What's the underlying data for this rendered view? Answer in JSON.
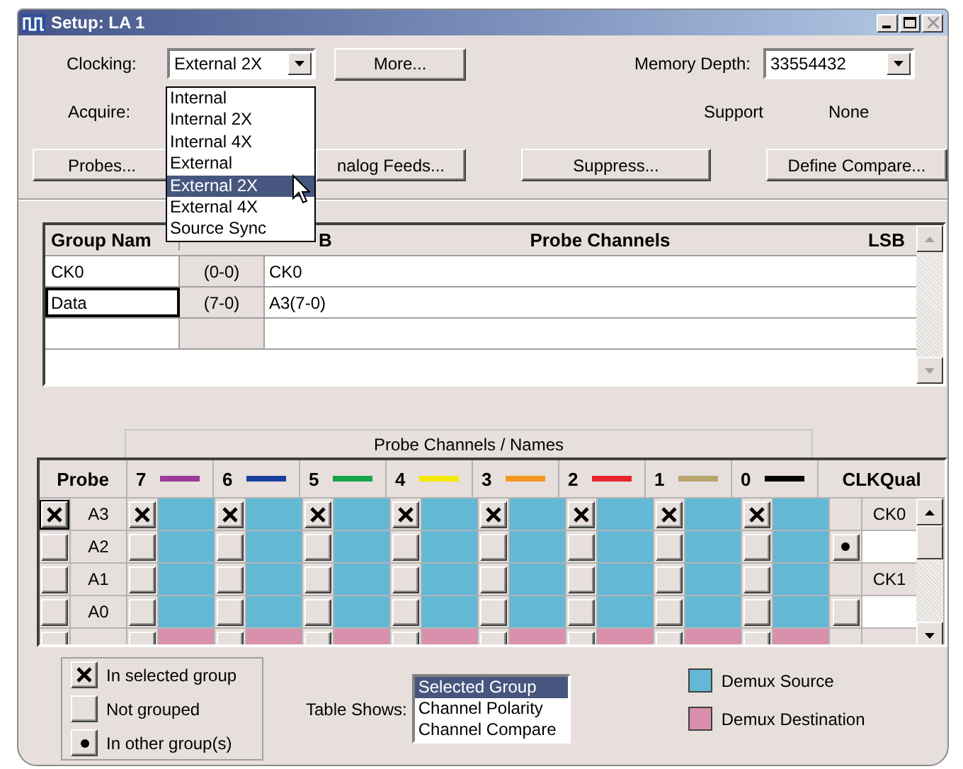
{
  "window": {
    "title": "Setup: LA 1"
  },
  "clocking": {
    "label": "Clocking:",
    "value": "External 2X",
    "options": [
      {
        "label": "Internal",
        "selected": false
      },
      {
        "label": "Internal 2X",
        "selected": false
      },
      {
        "label": "Internal 4X",
        "selected": false
      },
      {
        "label": "External",
        "selected": false
      },
      {
        "label": "External 2X",
        "selected": true
      },
      {
        "label": "External 4X",
        "selected": false
      },
      {
        "label": "Source Sync",
        "selected": false
      }
    ]
  },
  "more_button": "More...",
  "memory_depth": {
    "label": "Memory Depth:",
    "value": "33554432"
  },
  "acquire_label": "Acquire:",
  "support": {
    "label": "Support",
    "value": "None"
  },
  "buttons": [
    "Probes...",
    "nalog Feeds...",
    "Suppress...",
    "Define Compare..."
  ],
  "group_table": {
    "group_header": "Group Nam",
    "msb_header": "B",
    "channels_header": "Probe Channels",
    "lsb_header": "LSB",
    "rows": [
      {
        "name": "CK0",
        "range": "(0-0)",
        "channels": "CK0",
        "selected": false
      },
      {
        "name": "Data",
        "range": "(7-0)",
        "channels": "A3(7-0)",
        "selected": true
      }
    ]
  },
  "probe_grid": {
    "caption": "Probe Channels / Names",
    "probe_header": "Probe",
    "clk_header": "CLKQual",
    "channels": [
      {
        "label": "7",
        "color": "#9b3a9b"
      },
      {
        "label": "6",
        "color": "#1a3fa0"
      },
      {
        "label": "5",
        "color": "#17a34a"
      },
      {
        "label": "4",
        "color": "#f5e900"
      },
      {
        "label": "3",
        "color": "#f7961e"
      },
      {
        "label": "2",
        "color": "#e8242c"
      },
      {
        "label": "1",
        "color": "#b9a66e"
      },
      {
        "label": "0",
        "color": "#000000"
      }
    ],
    "rows": [
      {
        "probe": "A3",
        "kind": "source",
        "checked": true,
        "channels": [
          true,
          true,
          true,
          true,
          true,
          true,
          true,
          true
        ],
        "clk": {
          "kind": "label",
          "label": "CK0"
        }
      },
      {
        "probe": "A2",
        "kind": "source",
        "checked": false,
        "channels": [
          false,
          false,
          false,
          false,
          false,
          false,
          false,
          false
        ],
        "clk": {
          "kind": "dot"
        }
      },
      {
        "probe": "A1",
        "kind": "source",
        "checked": false,
        "channels": [
          false,
          false,
          false,
          false,
          false,
          false,
          false,
          false
        ],
        "clk": {
          "kind": "label",
          "label": "CK1"
        }
      },
      {
        "probe": "A0",
        "kind": "source",
        "checked": false,
        "channels": [
          false,
          false,
          false,
          false,
          false,
          false,
          false,
          false
        ],
        "clk": {
          "kind": "button"
        }
      },
      {
        "kind": "destination",
        "checked": false,
        "channels": [
          false,
          false,
          false,
          false,
          false,
          false,
          false,
          false
        ],
        "clk": {
          "kind": "blank"
        }
      }
    ]
  },
  "legend": {
    "marks": [
      {
        "kind": "selected",
        "label": "In selected group"
      },
      {
        "kind": "ungrouped",
        "label": "Not grouped"
      },
      {
        "kind": "other",
        "label": "In other group(s)"
      }
    ],
    "table_shows": {
      "label": "Table Shows:",
      "options": [
        {
          "label": "Selected Group",
          "selected": true
        },
        {
          "label": "Channel Polarity",
          "selected": false
        },
        {
          "label": "Channel Compare",
          "selected": false
        }
      ]
    },
    "demux": [
      {
        "kind": "source",
        "label": "Demux Source",
        "color": "#63b8d6"
      },
      {
        "kind": "destination",
        "label": "Demux Destination",
        "color": "#d990ac"
      }
    ]
  }
}
